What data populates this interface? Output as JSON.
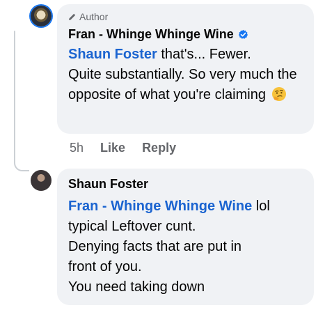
{
  "comment1": {
    "badge": "Author",
    "author": "Fran - Whinge Whinge Wine",
    "mention": "Shaun Foster",
    "text_line1": " that's... Fewer.",
    "text_rest": "Quite substantially. So very much the opposite of what you're claiming",
    "emoji": "thinking-face-icon",
    "time": "5h",
    "like_label": "Like",
    "reply_label": "Reply"
  },
  "comment2": {
    "author": "Shaun Foster",
    "mention": "Fran - Whinge Whinge Wine",
    "line1_rest": " lol",
    "line2": "typical Leftover cunt.",
    "line3": "Denying facts that are put in",
    "line4": "front of you.",
    "line5": "You need taking down"
  },
  "colors": {
    "bubble": "#f0f2f5",
    "mention": "#1b64d0",
    "verified": "#1877f2",
    "muted": "#65676b"
  }
}
